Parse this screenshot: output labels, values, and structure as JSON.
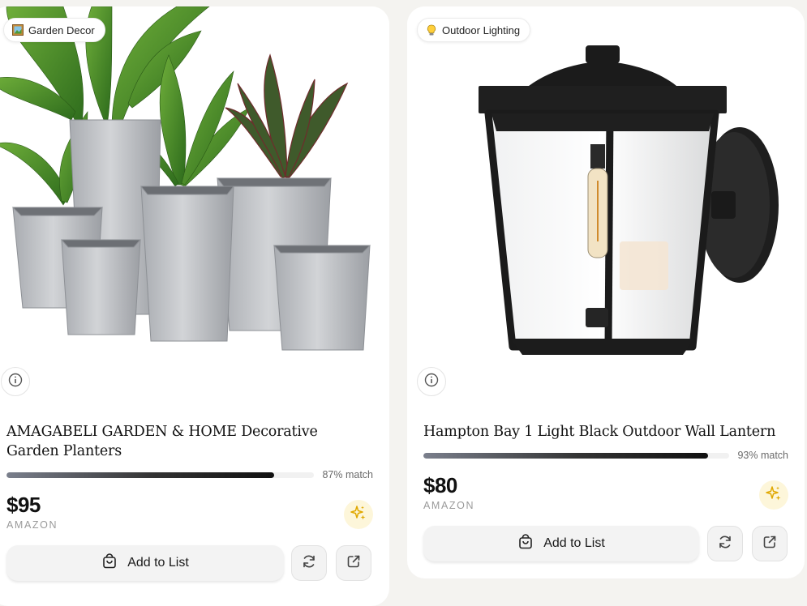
{
  "products": [
    {
      "category": "Garden Decor",
      "category_icon": "framed-picture-icon",
      "title": "AMAGABELI GARDEN & HOME Decorative Garden Planters",
      "match_fraction": 0.87,
      "match_label": "87% match",
      "price": "$95",
      "store": "AMAZON",
      "add_label": "Add to List"
    },
    {
      "category": "Outdoor Lighting",
      "category_icon": "light-bulb-icon",
      "title": "Hampton Bay 1 Light Black Outdoor Wall Lantern",
      "match_fraction": 0.93,
      "match_label": "93% match",
      "price": "$80",
      "store": "AMAZON",
      "add_label": "Add to List"
    }
  ],
  "colors": {
    "page_bg": "#f4f3f0",
    "card_bg": "#ffffff",
    "sparkle": "#e0a800",
    "sparkle_bg": "#fdf6da",
    "button_bg": "#f3f3f3",
    "planter": "#b9bcc0",
    "lantern_frame": "#1b1b1b"
  }
}
